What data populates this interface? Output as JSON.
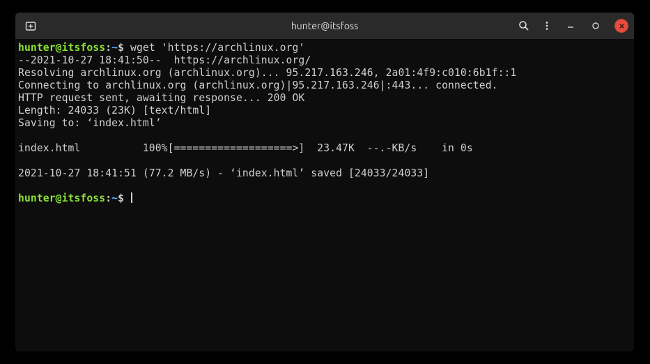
{
  "titlebar": {
    "title": "hunter@itsfoss"
  },
  "prompt": {
    "user_host": "hunter@itsfoss",
    "sep": ":",
    "cwd": "~",
    "symbol": "$"
  },
  "terminal": {
    "command": "wget 'https://archlinux.org'",
    "lines": [
      "--2021-10-27 18:41:50--  https://archlinux.org/",
      "Resolving archlinux.org (archlinux.org)... 95.217.163.246, 2a01:4f9:c010:6b1f::1",
      "Connecting to archlinux.org (archlinux.org)|95.217.163.246|:443... connected.",
      "HTTP request sent, awaiting response... 200 OK",
      "Length: 24033 (23K) [text/html]",
      "Saving to: ‘index.html’",
      "",
      "index.html          100%[===================>]  23.47K  --.-KB/s    in 0s",
      "",
      "2021-10-27 18:41:51 (77.2 MB/s) - ‘index.html’ saved [24033/24033]",
      ""
    ]
  }
}
